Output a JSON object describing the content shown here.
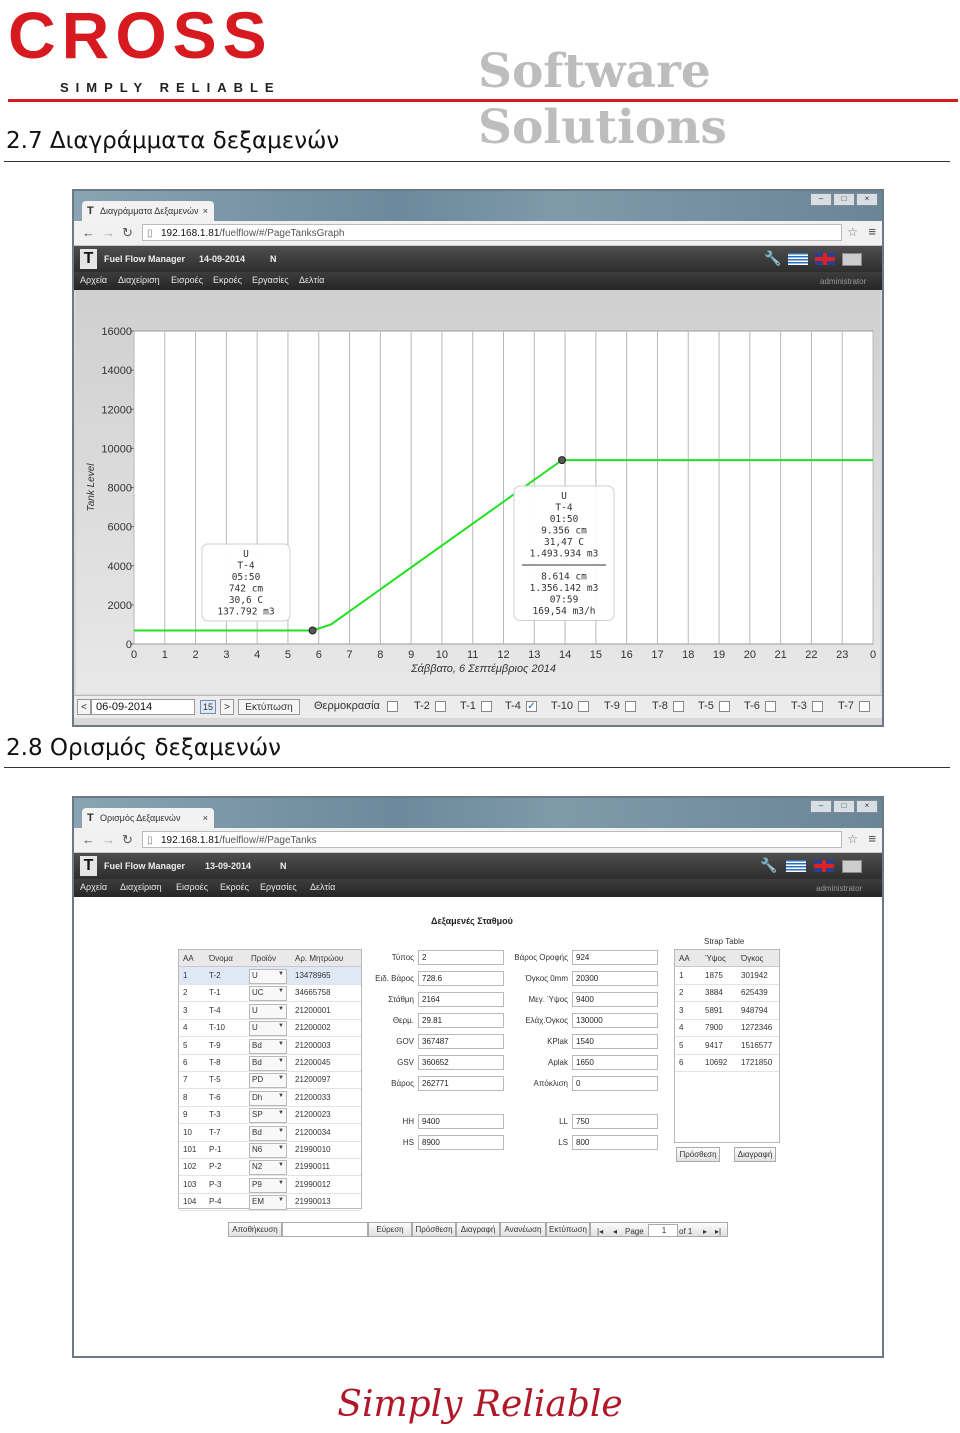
{
  "header": {
    "logo": "CROSS",
    "logo_tagline": "SIMPLY RELIABLE",
    "brand": "Software Solutions"
  },
  "section1": {
    "title": "2.7 Διαγράμματα δεξαμενών",
    "browser": {
      "tab_title": "Διαγράμματα Δεξαμενών",
      "url_host": "192.168.1.81",
      "url_path": "/fuelflow/#/PageTanksGraph",
      "app_title": "Fuel Flow Manager",
      "app_date": "14-09-2014",
      "app_flag": "N",
      "menu": [
        "Αρχεία",
        "Διαχείριση",
        "Εισροές",
        "Εκροές",
        "Εργασίες",
        "Δελτία"
      ],
      "user": "administrator"
    },
    "controls": {
      "prev": "<",
      "date": "06-09-2014",
      "cal": "15",
      "next": ">",
      "print": "Εκτύπωση",
      "temperature": "Θερμοκρασία",
      "tanks": [
        {
          "label": "T-2",
          "checked": false
        },
        {
          "label": "T-1",
          "checked": false
        },
        {
          "label": "T-4",
          "checked": true
        },
        {
          "label": "T-10",
          "checked": false
        },
        {
          "label": "T-9",
          "checked": false
        },
        {
          "label": "T-8",
          "checked": false
        },
        {
          "label": "T-5",
          "checked": false
        },
        {
          "label": "T-6",
          "checked": false
        },
        {
          "label": "T-3",
          "checked": false
        },
        {
          "label": "T-7",
          "checked": false
        }
      ]
    }
  },
  "chart_data": {
    "type": "line",
    "ylabel": "Tank Level",
    "xlabel": "Σάββατο, 6 Σεπτέμβριος 2014",
    "ylim": [
      0,
      16000
    ],
    "yticks": [
      0,
      2000,
      4000,
      6000,
      8000,
      10000,
      12000,
      14000,
      16000
    ],
    "xticks": [
      "0",
      "1",
      "2",
      "3",
      "4",
      "5",
      "6",
      "7",
      "8",
      "9",
      "10",
      "11",
      "12",
      "13",
      "14",
      "15",
      "16",
      "17",
      "18",
      "19",
      "20",
      "21",
      "22",
      "23",
      "0"
    ],
    "xlim": [
      0,
      24
    ],
    "grid": true,
    "line_color": "#22e022",
    "series": [
      {
        "x": [
          0,
          5.8,
          6.4,
          13.9,
          24
        ],
        "y": [
          690,
          690,
          1000,
          9400,
          9400
        ]
      }
    ],
    "markers": [
      {
        "x": 5.8,
        "y": 690
      },
      {
        "x": 13.9,
        "y": 9400
      }
    ],
    "tooltips": [
      {
        "lines": [
          "U",
          "T-4",
          "05:50",
          "742 cm",
          "30,6 C",
          "137.792 m3"
        ]
      },
      {
        "lines": [
          "U",
          "T-4",
          "01:50",
          "9.356 cm",
          "31,47 C",
          "1.493.934 m3",
          "",
          "8.614 cm",
          "1.356.142 m3",
          "07:59",
          "169,54 m3/h"
        ]
      }
    ]
  },
  "section2": {
    "title": "2.8 Ορισμός δεξαμενών",
    "browser": {
      "tab_title": "Ορισμός Δεξαμενών",
      "url_host": "192.168.1.81",
      "url_path": "/fuelflow/#/PageTanks",
      "app_title": "Fuel Flow Manager",
      "app_date": "13-09-2014",
      "app_flag": "N",
      "menu": [
        "Αρχεία",
        "Διαχείριση",
        "Εισροές",
        "Εκροές",
        "Εργασίες",
        "Δελτία"
      ],
      "user": "administrator"
    },
    "page_title": "Δεξαμενές Σταθμού",
    "tanks_table": {
      "headers": [
        "ΑΑ",
        "Όνομα",
        "Προϊόν",
        "Αρ. Μητρώου"
      ],
      "rows": [
        [
          "1",
          "T-2",
          "U",
          "13478965"
        ],
        [
          "2",
          "T-1",
          "UC",
          "34665758"
        ],
        [
          "3",
          "T-4",
          "U",
          "21200001"
        ],
        [
          "4",
          "T-10",
          "U",
          "21200002"
        ],
        [
          "5",
          "T-9",
          "Bd",
          "21200003"
        ],
        [
          "6",
          "T-8",
          "Bd",
          "21200045"
        ],
        [
          "7",
          "T-5",
          "PD",
          "21200097"
        ],
        [
          "8",
          "T-6",
          "Dh",
          "21200033"
        ],
        [
          "9",
          "T-3",
          "SP",
          "21200023"
        ],
        [
          "10",
          "T-7",
          "Bd",
          "21200034"
        ],
        [
          "101",
          "P-1",
          "N6",
          "21990010"
        ],
        [
          "102",
          "P-2",
          "N2",
          "21990011"
        ],
        [
          "103",
          "P-3",
          "P9",
          "21990012"
        ],
        [
          "104",
          "P-4",
          "EM",
          "21990013"
        ]
      ]
    },
    "form_left": [
      {
        "label": "Τύπος",
        "value": "2"
      },
      {
        "label": "Ειδ. Βάρος",
        "value": "728.6"
      },
      {
        "label": "Στάθμη",
        "value": "2164"
      },
      {
        "label": "Θερμ.",
        "value": "29.81"
      },
      {
        "label": "GOV",
        "value": "367487"
      },
      {
        "label": "GSV",
        "value": "360652"
      },
      {
        "label": "Βάρος",
        "value": "262771"
      }
    ],
    "form_right": [
      {
        "label": "Βάρος Οροφής",
        "value": "924"
      },
      {
        "label": "Όγκος 0mm",
        "value": "20300"
      },
      {
        "label": "Μεγ. Ύψος",
        "value": "9400"
      },
      {
        "label": "Ελάχ.Όγκος",
        "value": "130000"
      },
      {
        "label": "KPlak",
        "value": "1540"
      },
      {
        "label": "Aplak",
        "value": "1650"
      },
      {
        "label": "Απόκλιση",
        "value": "0"
      }
    ],
    "form_left2": [
      {
        "label": "HH",
        "value": "9400"
      },
      {
        "label": "HS",
        "value": "8900"
      }
    ],
    "form_right2": [
      {
        "label": "LL",
        "value": "750"
      },
      {
        "label": "LS",
        "value": "800"
      }
    ],
    "strap_table": {
      "title": "Strap Table",
      "headers": [
        "ΑΑ",
        "Ύψος",
        "Όγκος"
      ],
      "rows": [
        [
          "1",
          "1875",
          "301942"
        ],
        [
          "2",
          "3884",
          "625439"
        ],
        [
          "3",
          "5891",
          "948794"
        ],
        [
          "4",
          "7900",
          "1272346"
        ],
        [
          "5",
          "9417",
          "1516577"
        ],
        [
          "6",
          "10692",
          "1721850"
        ]
      ],
      "add": "Πρόσθεση",
      "delete": "Διαγραφή"
    },
    "toolbar": {
      "save": "Αποθήκευση",
      "find": "Εύρεση",
      "add": "Πρόσθεση",
      "delete": "Διαγραφή",
      "refresh": "Ανανέωση",
      "print": "Εκτύπωση",
      "page_label": "Page",
      "page_value": "1",
      "of_label": "of 1"
    }
  },
  "footer": {
    "slogan": "Simply Reliable"
  }
}
